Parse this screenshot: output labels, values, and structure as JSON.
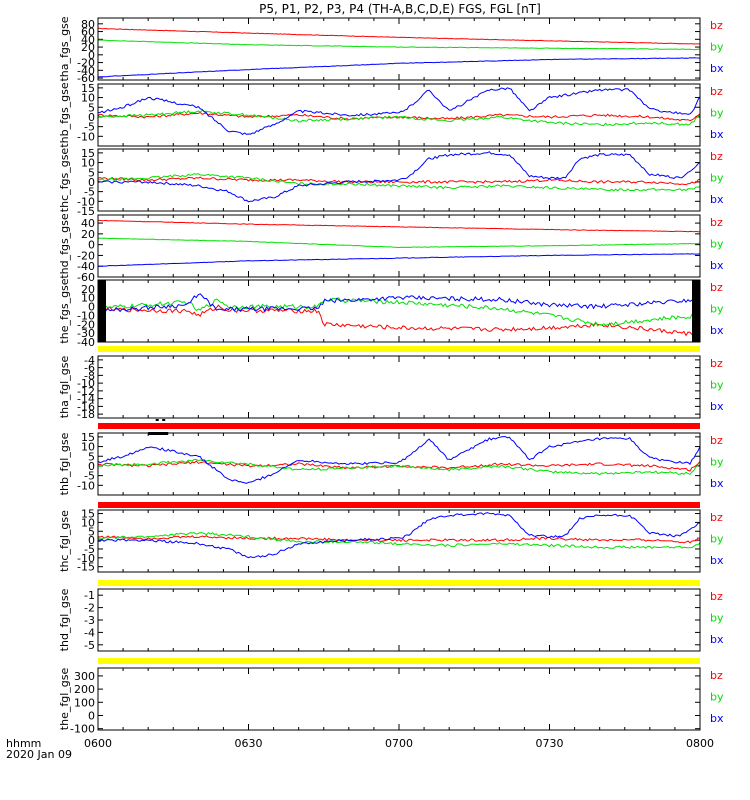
{
  "title": "P5, P1, P2, P3, P4 (TH-A,B,C,D,E) FGS, FGL [nT]",
  "x_label_lines": [
    "hhmm",
    "2020 Jan 09"
  ],
  "x_ticks": [
    "0600",
    "0630",
    "0700",
    "0730",
    "0800"
  ],
  "legend": [
    "bz",
    "by",
    "bx"
  ],
  "colors": {
    "bx": "#0000ff",
    "by": "#00e000",
    "bz": "#ff0000",
    "yellow": "#ffff00",
    "red": "#ff0000",
    "black": "#000000"
  },
  "chart_data": {
    "type": "line",
    "x_range": [
      "06:00",
      "08:00"
    ],
    "panels": [
      {
        "ylabel": "tha_fgs_gse",
        "ylim": [
          -65,
          95
        ],
        "ticks": [
          -60,
          -40,
          -20,
          0,
          20,
          40,
          60,
          80
        ],
        "series": [
          {
            "name": "bz",
            "x_min": [
              0,
              30,
              60,
              90,
              120
            ],
            "values": [
              68,
              56,
              45,
              36,
              28
            ]
          },
          {
            "name": "by",
            "x_min": [
              0,
              30,
              60,
              90,
              120
            ],
            "values": [
              38,
              26,
              20,
              17,
              14
            ]
          },
          {
            "name": "bx",
            "x_min": [
              0,
              30,
              60,
              90,
              120
            ],
            "values": [
              -57,
              -38,
              -22,
              -12,
              -8
            ]
          }
        ]
      },
      {
        "ylabel": "thb_fgs_gse",
        "ylim": [
          -15,
          17
        ],
        "ticks": [
          -10,
          -5,
          0,
          5,
          10,
          15
        ],
        "series": [
          {
            "name": "bz",
            "x_min": [
              0,
              10,
              20,
              30,
              40,
              50,
              60,
              70,
              80,
              90,
              100,
              110,
              118,
              120
            ],
            "values": [
              1,
              0,
              2,
              0,
              1,
              -1,
              0,
              -1,
              1,
              0,
              1,
              0,
              -2,
              2
            ]
          },
          {
            "name": "by",
            "x_min": [
              0,
              10,
              20,
              30,
              40,
              50,
              60,
              70,
              80,
              90,
              100,
              110,
              118,
              120
            ],
            "values": [
              0,
              1,
              3,
              1,
              -2,
              -1,
              0,
              -2,
              0,
              -3,
              -4,
              -3,
              -4,
              1
            ]
          },
          {
            "name": "bx",
            "x_min": [
              0,
              5,
              10,
              20,
              26,
              30,
              35,
              40,
              50,
              60,
              62,
              66,
              70,
              78,
              82,
              86,
              90,
              100,
              106,
              110,
              118,
              120
            ],
            "values": [
              2,
              5,
              10,
              5,
              -7,
              -9,
              -4,
              3,
              1,
              2,
              5,
              14,
              3,
              14,
              15,
              3,
              10,
              14,
              14,
              4,
              1,
              10
            ]
          }
        ]
      },
      {
        "ylabel": "thc_fgs_gse",
        "ylim": [
          -15,
          17
        ],
        "ticks": [
          -15,
          -10,
          -5,
          0,
          5,
          10,
          15
        ],
        "series": [
          {
            "name": "bz",
            "x_min": [
              0,
              10,
              20,
              30,
              40,
              50,
              60,
              70,
              80,
              90,
              100,
              110,
              118,
              120
            ],
            "values": [
              2,
              1,
              2,
              1,
              1,
              0,
              0,
              0,
              0,
              1,
              0,
              0,
              -1,
              1
            ]
          },
          {
            "name": "by",
            "x_min": [
              0,
              10,
              20,
              30,
              40,
              50,
              60,
              70,
              80,
              90,
              100,
              110,
              118,
              120
            ],
            "values": [
              1,
              2,
              4,
              2,
              -1,
              -1,
              -2,
              -3,
              -2,
              -3,
              -4,
              -4,
              -4,
              -2
            ]
          },
          {
            "name": "bx",
            "x_min": [
              0,
              10,
              20,
              26,
              30,
              35,
              40,
              50,
              60,
              62,
              66,
              70,
              78,
              82,
              86,
              90,
              93,
              96,
              100,
              106,
              110,
              116,
              120
            ],
            "values": [
              0,
              0,
              -2,
              -5,
              -10,
              -8,
              -2,
              0,
              1,
              3,
              12,
              14,
              15,
              14,
              3,
              2,
              2,
              12,
              14,
              14,
              4,
              2,
              10
            ]
          }
        ]
      },
      {
        "ylabel": "thd_fgs_gse",
        "ylim": [
          -60,
          55
        ],
        "ticks": [
          -60,
          -40,
          -20,
          0,
          20,
          40
        ],
        "series": [
          {
            "name": "bz",
            "x_min": [
              0,
              30,
              60,
              90,
              120
            ],
            "values": [
              45,
              38,
              33,
              28,
              24
            ]
          },
          {
            "name": "by",
            "x_min": [
              0,
              30,
              60,
              90,
              120
            ],
            "values": [
              12,
              6,
              -5,
              -2,
              2
            ]
          },
          {
            "name": "bx",
            "x_min": [
              0,
              30,
              60,
              90,
              120
            ],
            "values": [
              -40,
              -30,
              -25,
              -20,
              -17
            ]
          }
        ]
      },
      {
        "ylabel": "the_fgs_gse",
        "ylim": [
          -40,
          30
        ],
        "ticks": [
          -40,
          -30,
          -20,
          -10,
          0,
          10,
          20
        ],
        "series": [
          {
            "name": "bz",
            "x_min": [
              0,
              18,
              20,
              24,
              26,
              44,
              45,
              60,
              80,
              90,
              100,
              110,
              120
            ],
            "values": [
              -3,
              -5,
              -10,
              0,
              -4,
              -5,
              -20,
              -24,
              -26,
              -24,
              -20,
              -26,
              -32
            ]
          },
          {
            "name": "by",
            "x_min": [
              0,
              18,
              20,
              24,
              26,
              44,
              45,
              60,
              80,
              90,
              100,
              110,
              120
            ],
            "values": [
              -2,
              5,
              -5,
              8,
              0,
              0,
              8,
              5,
              -2,
              -10,
              -20,
              -15,
              -10
            ]
          },
          {
            "name": "bx",
            "x_min": [
              0,
              18,
              20,
              24,
              26,
              44,
              45,
              60,
              80,
              90,
              100,
              110,
              120
            ],
            "values": [
              -5,
              2,
              15,
              -5,
              -3,
              -2,
              6,
              10,
              8,
              2,
              0,
              4,
              8
            ]
          }
        ]
      },
      {
        "ylabel": "tha_fgl_gse",
        "ylim": [
          -19,
          -3
        ],
        "ticks": [
          -18,
          -16,
          -14,
          -12,
          -10,
          -8,
          -6,
          -4
        ],
        "series": []
      },
      {
        "ylabel": "thb_fgl_gse",
        "ylim": [
          -15,
          17
        ],
        "ticks": [
          -10,
          -5,
          0,
          5,
          10,
          15
        ],
        "series": [
          {
            "name": "bz",
            "x_min": [
              0,
              10,
              20,
              30,
              40,
              50,
              60,
              70,
              80,
              90,
              100,
              110,
              118,
              120
            ],
            "values": [
              1,
              0,
              2,
              0,
              1,
              -1,
              0,
              -1,
              1,
              0,
              1,
              0,
              -2,
              2
            ]
          },
          {
            "name": "by",
            "x_min": [
              0,
              10,
              20,
              30,
              40,
              50,
              60,
              70,
              80,
              90,
              100,
              110,
              118,
              120
            ],
            "values": [
              0,
              1,
              3,
              1,
              -2,
              -1,
              0,
              -2,
              0,
              -3,
              -4,
              -3,
              -4,
              1
            ]
          },
          {
            "name": "bx",
            "x_min": [
              0,
              5,
              10,
              20,
              26,
              30,
              35,
              40,
              50,
              60,
              62,
              66,
              70,
              78,
              82,
              86,
              90,
              100,
              106,
              110,
              118,
              120
            ],
            "values": [
              2,
              5,
              10,
              5,
              -7,
              -9,
              -4,
              3,
              1,
              2,
              5,
              14,
              3,
              14,
              15,
              3,
              10,
              14,
              14,
              4,
              1,
              10
            ]
          }
        ]
      },
      {
        "ylabel": "thc_fgl_gse",
        "ylim": [
          -18,
          17
        ],
        "ticks": [
          -15,
          -10,
          -5,
          0,
          5,
          10,
          15
        ],
        "series": [
          {
            "name": "bz",
            "x_min": [
              0,
              10,
              20,
              30,
              40,
              50,
              60,
              70,
              80,
              90,
              100,
              110,
              118,
              120
            ],
            "values": [
              2,
              1,
              2,
              1,
              1,
              0,
              0,
              0,
              0,
              1,
              0,
              0,
              -1,
              1
            ]
          },
          {
            "name": "by",
            "x_min": [
              0,
              10,
              20,
              30,
              40,
              50,
              60,
              70,
              80,
              90,
              100,
              110,
              118,
              120
            ],
            "values": [
              1,
              2,
              4,
              2,
              -1,
              -1,
              -2,
              -3,
              -2,
              -3,
              -4,
              -4,
              -4,
              -2
            ]
          },
          {
            "name": "bx",
            "x_min": [
              0,
              10,
              20,
              26,
              30,
              35,
              40,
              50,
              60,
              62,
              66,
              70,
              78,
              82,
              86,
              90,
              93,
              96,
              100,
              106,
              110,
              116,
              120
            ],
            "values": [
              0,
              0,
              -2,
              -5,
              -10,
              -8,
              -2,
              0,
              1,
              3,
              12,
              14,
              15,
              14,
              3,
              2,
              2,
              12,
              14,
              14,
              4,
              2,
              10
            ]
          }
        ]
      },
      {
        "ylabel": "thd_fgl_gse",
        "ylim": [
          -5.5,
          -0.5
        ],
        "ticks": [
          -5,
          -4,
          -3,
          -2,
          -1
        ],
        "series": []
      },
      {
        "ylabel": "the_fgl_gse",
        "ylim": [
          -110,
          360
        ],
        "ticks": [
          -100,
          0,
          100,
          200,
          300
        ],
        "series": []
      }
    ],
    "status_bars": [
      "yellow",
      "red",
      "red",
      "yellow",
      "yellow"
    ]
  }
}
